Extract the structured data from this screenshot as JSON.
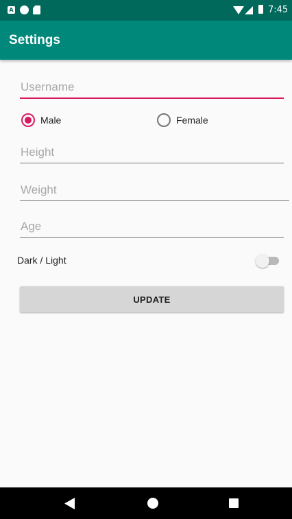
{
  "status_bar": {
    "time": "7:45",
    "icons": [
      "notification-a-icon",
      "notification-circle-icon",
      "sd-card-icon",
      "wifi-icon",
      "signal-icon",
      "battery-icon"
    ],
    "notification_a_glyph": "A"
  },
  "app_bar": {
    "title": "Settings",
    "color": "#00897b"
  },
  "form": {
    "username": {
      "placeholder": "Username",
      "value": ""
    },
    "gender": {
      "options": [
        {
          "label": "Male",
          "checked": true
        },
        {
          "label": "Female",
          "checked": false
        }
      ]
    },
    "height": {
      "placeholder": "Height",
      "value": ""
    },
    "weight": {
      "placeholder": "Weight",
      "value": ""
    },
    "age": {
      "placeholder": "Age",
      "value": ""
    },
    "theme_switch": {
      "label": "Dark / Light",
      "on": false
    },
    "update_label": "UPDATE"
  },
  "colors": {
    "accent": "#d81b60",
    "primary": "#00897b",
    "primary_dark": "#00695c"
  },
  "nav_bar": {
    "icons": [
      "back-icon",
      "home-icon",
      "recents-icon"
    ]
  }
}
